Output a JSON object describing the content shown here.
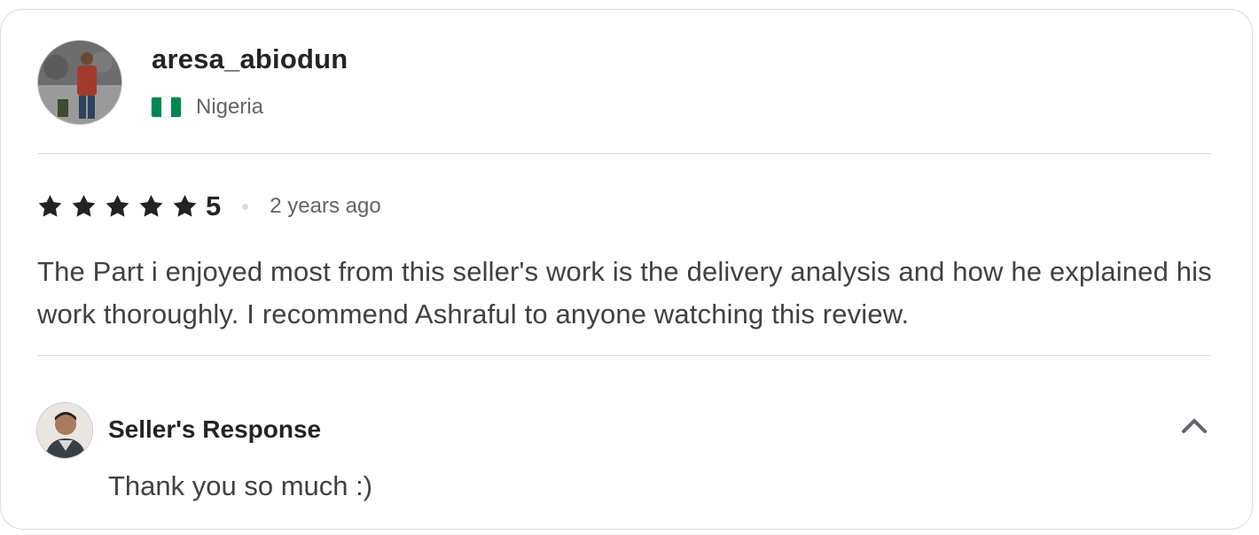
{
  "reviewer": {
    "username": "aresa_abiodun",
    "country": "Nigeria",
    "flag_colors": [
      "#008751",
      "#ffffff",
      "#008751"
    ]
  },
  "review": {
    "star_icons": [
      "star-icon",
      "star-icon",
      "star-icon",
      "star-icon",
      "star-icon"
    ],
    "rating": "5",
    "time_ago": "2 years ago",
    "text": "The Part i enjoyed most from this seller's work is the delivery analysis and how he explained his work thoroughly. I recommend Ashraful to anyone watching this review."
  },
  "seller_response": {
    "title": "Seller's Response",
    "text": "Thank you so much :)",
    "toggle_icon": "chevron-up-icon"
  },
  "colors": {
    "star": "#222325",
    "text_primary": "#222325",
    "text_secondary": "#62646a",
    "border": "#dadbdd"
  }
}
